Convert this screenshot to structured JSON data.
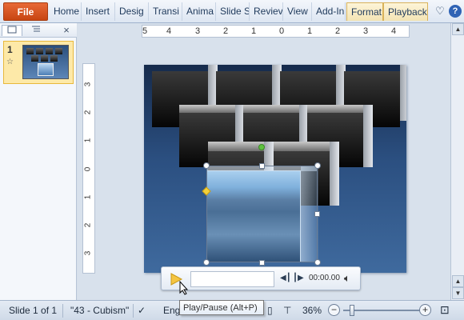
{
  "ribbon": {
    "file_tab": "File",
    "tabs": [
      "Home",
      "Insert",
      "Desig",
      "Transi",
      "Anima",
      "Slide S",
      "Reviev",
      "View",
      "Add-In"
    ],
    "context_tabs": [
      "Format",
      "Playback"
    ],
    "help_icon": "help-icon",
    "minimize_icon": "minimize-ribbon-icon"
  },
  "left_pane": {
    "slides_tab_icon": "slides-icon",
    "outline_tab_icon": "outline-icon",
    "close_label": "×",
    "slide_number": "1",
    "star_glyph": "☆"
  },
  "ruler": {
    "horizontal": [
      "5",
      "4",
      "3",
      "2",
      "1",
      "0",
      "1",
      "2",
      "3",
      "4"
    ],
    "vertical": [
      "3",
      "2",
      "1",
      "0",
      "1",
      "2",
      "3"
    ]
  },
  "media": {
    "time": "00:00.00",
    "play_icon": "play-icon",
    "prev_icon": "step-back-icon",
    "next_icon": "step-forward-icon",
    "volume_icon": "volume-icon"
  },
  "status": {
    "slide_info": "Slide 1 of 1",
    "theme": "\"43 - Cubism\"",
    "language": "Eng",
    "zoom": "36%",
    "zoom_minus": "−",
    "zoom_plus": "+"
  },
  "tooltip": {
    "text": "Play/Pause (Alt+P)"
  },
  "colors": {
    "file_tab": "#d35a22",
    "slide_top": "#162b4c",
    "slide_bottom": "#3f6a9e",
    "rotate_handle": "#5ec23f",
    "adjust_handle": "#f3d13b"
  }
}
